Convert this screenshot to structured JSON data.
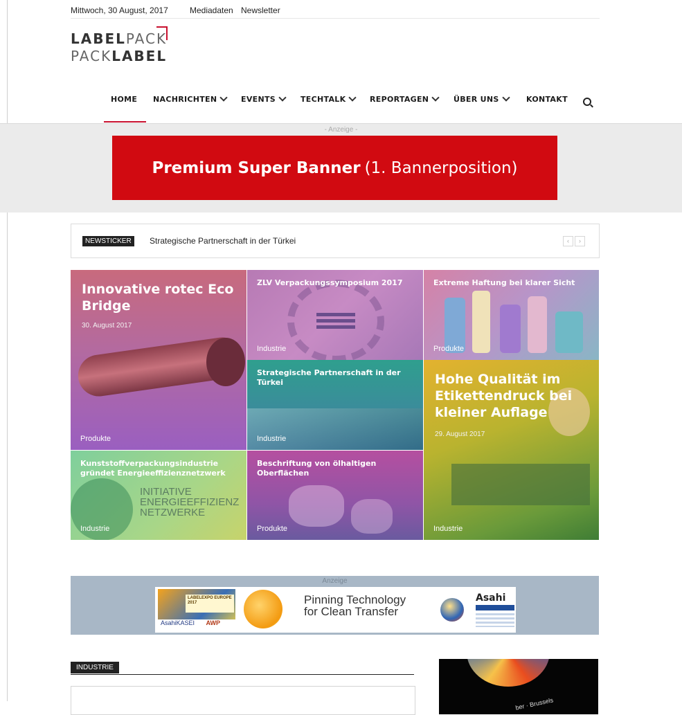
{
  "topbar": {
    "date": "Mittwoch, 30 August, 2017",
    "links": [
      "Mediadaten",
      "Newsletter"
    ]
  },
  "logo": {
    "line1_bold": "LABEL",
    "line1_light": "PACK",
    "line2_light": "PACK",
    "line2_bold": "LABEL"
  },
  "nav": {
    "items": [
      "HOME",
      "NACHRICHTEN",
      "EVENTS",
      "TECHTALK",
      "REPORTAGEN",
      "ÜBER UNS",
      "KONTAKT"
    ],
    "active": "HOME"
  },
  "banner": {
    "anzeige": "- Anzeige -",
    "bold": "Premium Super Banner",
    "rest": "(1. Bannerposition)"
  },
  "ticker": {
    "badge": "NEWSTICKER",
    "text": "Strategische Partnerschaft in der Türkei",
    "prev": "‹",
    "next": "›"
  },
  "tiles": [
    {
      "title": "Innovative rotec Eco Bridge",
      "date": "30. August 2017",
      "category": "Produkte"
    },
    {
      "title": "ZLV Verpackungssymposium 2017",
      "category": "Industrie"
    },
    {
      "title": "Extreme Haftung bei klarer Sicht",
      "category": "Produkte"
    },
    {
      "title": "Strategische Partnerschaft in der Türkei",
      "category": "Industrie"
    },
    {
      "title": "Hohe Qualität im Etikettendruck bei kleiner Auflage",
      "date": "29. August 2017",
      "category": "Industrie"
    },
    {
      "title": "Kunststoffverpackungsindustrie gründet Energieeffizienznetzwerk",
      "category": "Industrie",
      "image_text": "INITIATIVE ENERGIEEFFIZIENZ NETZWERKE"
    },
    {
      "title": "Beschriftung von ölhaltigen Oberflächen",
      "category": "Produkte"
    }
  ],
  "ad": {
    "label": "Anzeige",
    "headline": "Pinning Technology",
    "subline": "for Clean Transfer",
    "brand": "Asahi",
    "logo_text": "LABELEXPO EUROPE 2017",
    "bottom_left": "AsahiKASEI",
    "bottom_right": "AWP"
  },
  "section": {
    "label": "INDUSTRIE"
  },
  "side_ad": {
    "text": "ber · Brussels"
  },
  "colors": {
    "accent": "#d10a11",
    "nav_underline": "#c8102e",
    "ad_bg": "#a8b7c6"
  }
}
